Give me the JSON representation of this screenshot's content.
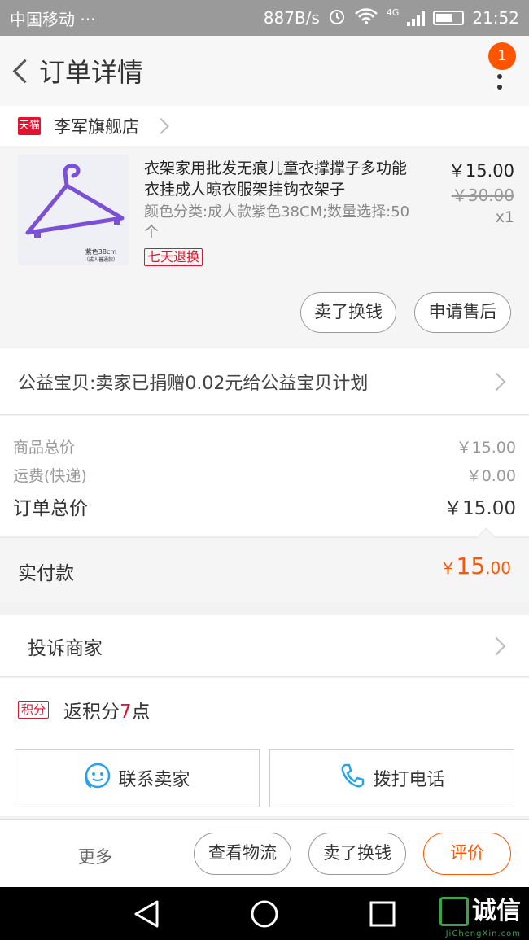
{
  "status_bar": {
    "carrier": "中国移动",
    "dots": "···",
    "net_speed": "887B/s",
    "network": "4G",
    "time": "21:52"
  },
  "header": {
    "title": "订单详情",
    "notification_count": "1"
  },
  "store": {
    "badge": "天猫",
    "name": "李军旗舰店"
  },
  "product": {
    "title": "衣架家用批发无痕儿童衣撑撑子多功能衣挂成人晾衣服架挂钩衣架子",
    "spec": "颜色分类:成人款紫色38CM;数量选择:50个",
    "tag": "七天退换",
    "price": "￥15.00",
    "original_price": "￥30.00",
    "quantity": "x1",
    "image_caption_line1": "紫色38cm",
    "image_caption_line2": "（成人普通款）",
    "sell_button": "卖了换钱",
    "aftersale_button": "申请售后"
  },
  "charity": {
    "text": "公益宝贝:卖家已捐赠0.02元给公益宝贝计划"
  },
  "summary": {
    "goods_label": "商品总价",
    "goods_value": "￥15.00",
    "shipping_label": "运费(快递)",
    "shipping_value": "￥0.00",
    "total_label": "订单总价",
    "total_value": "￥15.00"
  },
  "paid": {
    "label": "实付款",
    "symbol": "￥",
    "amount_int": "15",
    "amount_dec": ".00"
  },
  "complain": {
    "label": "投诉商家"
  },
  "points": {
    "badge": "积分",
    "prefix": "返积分",
    "value": "7",
    "suffix": "点"
  },
  "contact": {
    "seller_label": "联系卖家",
    "call_label": "拨打电话"
  },
  "actions": {
    "more": "更多",
    "logistics": "查看物流",
    "sell": "卖了换钱",
    "review": "评价"
  },
  "watermark": {
    "text": "诚信",
    "sub": "JiChengXin.com"
  },
  "colors": {
    "accent": "#ff5500",
    "tmall_red": "#e4122c",
    "hanger_purple": "#7b4fd6"
  }
}
